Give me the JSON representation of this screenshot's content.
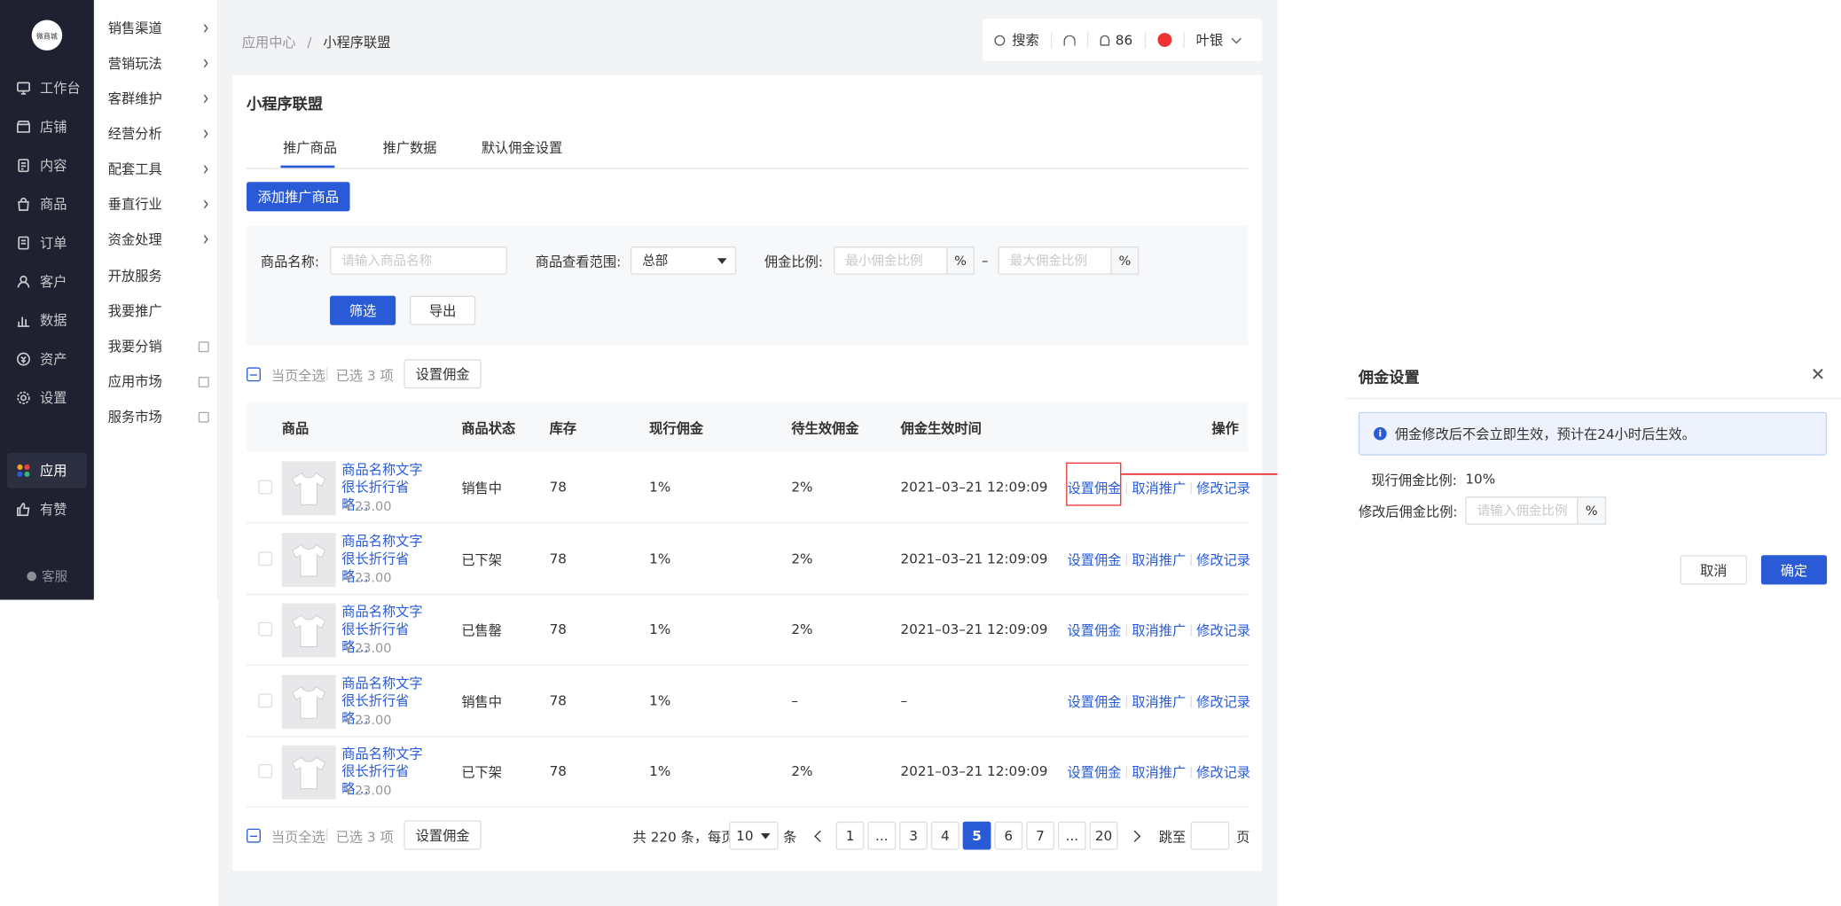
{
  "nav": {
    "logo_text": "微商城",
    "items": [
      {
        "label": "工作台",
        "icon": "monitor-icon"
      },
      {
        "label": "店铺",
        "icon": "shop-icon"
      },
      {
        "label": "内容",
        "icon": "document-icon"
      },
      {
        "label": "商品",
        "icon": "bag-icon"
      },
      {
        "label": "订单",
        "icon": "order-icon"
      },
      {
        "label": "客户",
        "icon": "user-icon"
      },
      {
        "label": "数据",
        "icon": "chart-icon"
      },
      {
        "label": "资产",
        "icon": "coin-icon"
      },
      {
        "label": "设置",
        "icon": "gear-icon"
      },
      {
        "label": "应用",
        "icon": "apps-icon"
      },
      {
        "label": "有赞",
        "icon": "thumb-icon"
      }
    ],
    "service": "客服"
  },
  "subnav": {
    "items": [
      {
        "label": "销售渠道"
      },
      {
        "label": "营销玩法"
      },
      {
        "label": "客群维护"
      },
      {
        "label": "经营分析"
      },
      {
        "label": "配套工具"
      },
      {
        "label": "垂直行业"
      },
      {
        "label": "资金处理"
      },
      {
        "label": "开放服务"
      },
      {
        "label": "我要推广"
      },
      {
        "label": "我要分销"
      },
      {
        "label": "应用市场"
      },
      {
        "label": "服务市场"
      }
    ]
  },
  "breadcrumb": {
    "parent": "应用中心",
    "sep": "/",
    "current": "小程序联盟"
  },
  "toolbar": {
    "search": "搜索",
    "bell_count": "86",
    "user": "叶银"
  },
  "page": {
    "title": "小程序联盟",
    "tabs": [
      "推广商品",
      "推广数据",
      "默认佣金设置"
    ],
    "add_button": "添加推广商品"
  },
  "filter": {
    "name_label": "商品名称:",
    "name_placeholder": "请输入商品名称",
    "range_label": "商品查看范围:",
    "range_value": "总部",
    "ratio_label": "佣金比例:",
    "min_placeholder": "最小佣金比例",
    "max_placeholder": "最大佣金比例",
    "percent": "%",
    "dash": "–",
    "filter_button": "筛选",
    "export_button": "导出"
  },
  "bulk": {
    "select_page": "当页全选",
    "selected": "已选 3 项",
    "set_button": "设置佣金"
  },
  "table": {
    "headers": [
      "商品",
      "商品状态",
      "库存",
      "现行佣金",
      "待生效佣金",
      "佣金生效时间",
      "操作"
    ],
    "ops": [
      "设置佣金",
      "取消推广",
      "修改记录"
    ],
    "rows": [
      {
        "name": "商品名称文字很长折行省略…",
        "price": "￥23.00",
        "status": "销售中",
        "stock": "78",
        "current": "1%",
        "pending": "2%",
        "time": "2021–03–21 12:09:09"
      },
      {
        "name": "商品名称文字很长折行省略…",
        "price": "￥23.00",
        "status": "已下架",
        "stock": "78",
        "current": "1%",
        "pending": "2%",
        "time": "2021–03–21 12:09:09"
      },
      {
        "name": "商品名称文字很长折行省略…",
        "price": "￥23.00",
        "status": "已售罄",
        "stock": "78",
        "current": "1%",
        "pending": "2%",
        "time": "2021–03–21 12:09:09"
      },
      {
        "name": "商品名称文字很长折行省略…",
        "price": "￥23.00",
        "status": "销售中",
        "stock": "78",
        "current": "1%",
        "pending": "–",
        "time": "–"
      },
      {
        "name": "商品名称文字很长折行省略…",
        "price": "￥23.00",
        "status": "已下架",
        "stock": "78",
        "current": "1%",
        "pending": "2%",
        "time": "2021–03–21 12:09:09"
      }
    ]
  },
  "pagination": {
    "total": "共 220 条，每页",
    "page_size": "10",
    "unit": "条",
    "pages": [
      "1",
      "...",
      "3",
      "4",
      "5",
      "6",
      "7",
      "...",
      "20"
    ],
    "current": "5",
    "jump": "跳至",
    "page_unit": "页"
  },
  "drawer": {
    "title": "佣金设置",
    "notice": "佣金修改后不会立即生效，预计在24小时后生效。",
    "current_label": "现行佣金比例:",
    "current_value": "10%",
    "new_label": "修改后佣金比例:",
    "new_placeholder": "请输入佣金比例",
    "percent": "%",
    "cancel": "取消",
    "confirm": "确定"
  },
  "colors": {
    "primary": "#2a5bd7",
    "nav_bg": "#1f2130",
    "highlight": "#e33333"
  }
}
